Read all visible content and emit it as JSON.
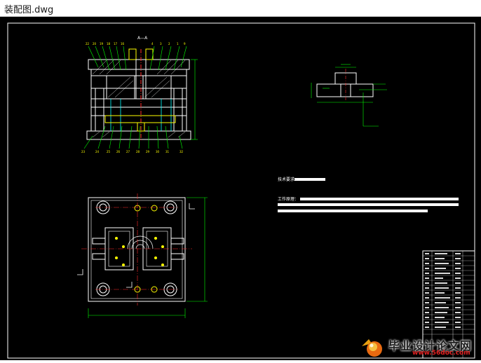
{
  "window": {
    "title": "装配图.dwg"
  },
  "drawing": {
    "section_label": "A—A",
    "tech_req_title": "技术要求",
    "work_title": "工作原理："
  },
  "watermark": {
    "name": "毕业设计论文网",
    "url": "www.56doc.com"
  },
  "colors": {
    "canvas": "#000000",
    "outline": "#ffffff",
    "dimension": "#00ff00",
    "center": "#ff2a2a",
    "hidden": "#ffff00",
    "cyan": "#00ffff"
  }
}
